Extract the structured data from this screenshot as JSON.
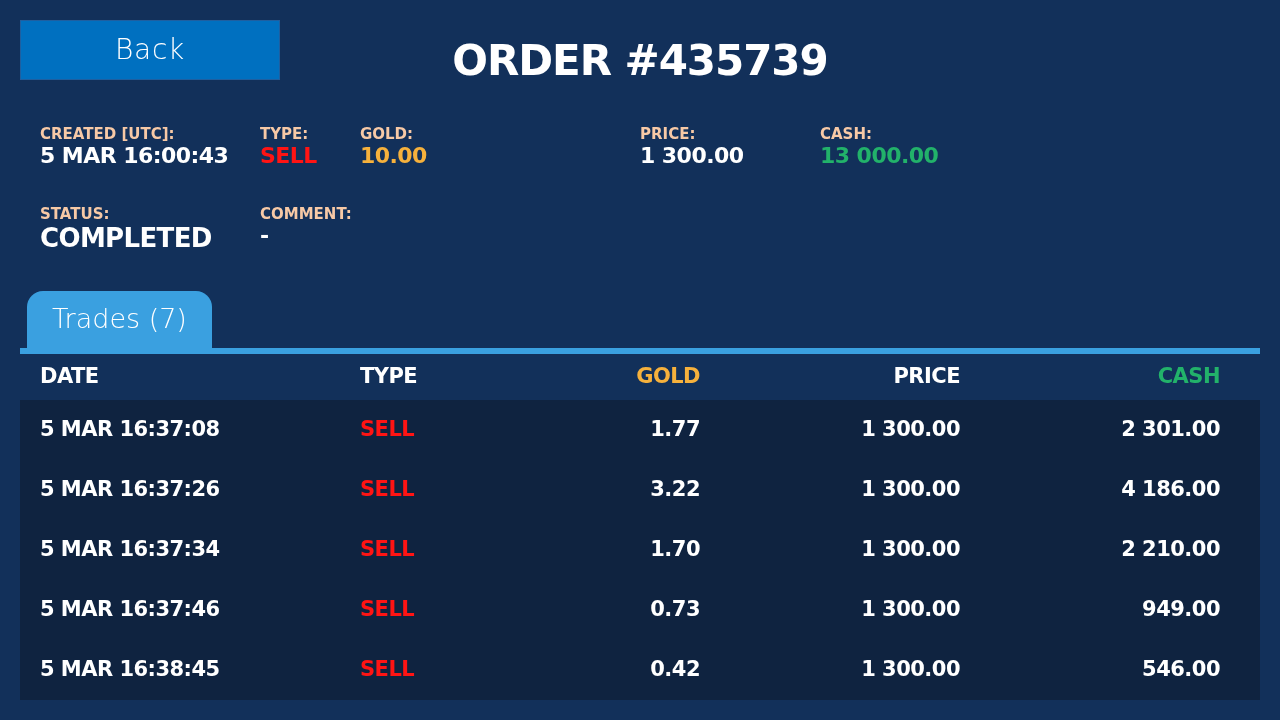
{
  "back_button": "Back",
  "title": "ORDER #435739",
  "detail_rows": [
    {
      "fields": [
        {
          "label": "CREATED [UTC]:",
          "value": "5 MAR 16:00:43",
          "kind": "plain"
        },
        {
          "label": "TYPE:",
          "value": "SELL",
          "kind": "sell"
        },
        {
          "label": "GOLD:",
          "value": "10.00",
          "kind": "gold"
        },
        {
          "label": "PRICE:",
          "value": "1 300.00",
          "kind": "plain"
        },
        {
          "label": "CASH:",
          "value": "13 000.00",
          "kind": "cash"
        }
      ]
    },
    {
      "fields": [
        {
          "label": "STATUS:",
          "value": "COMPLETED",
          "kind": "status"
        },
        {
          "label": "COMMENT:",
          "value": "-",
          "kind": "plain"
        }
      ]
    }
  ],
  "tabs": [
    {
      "label": "Trades (7)",
      "selected": true
    }
  ],
  "table": {
    "columns": [
      {
        "label": "DATE",
        "kind": "date"
      },
      {
        "label": "TYPE",
        "kind": "type"
      },
      {
        "label": "GOLD",
        "kind": "gold"
      },
      {
        "label": "PRICE",
        "kind": "price"
      },
      {
        "label": "CASH",
        "kind": "cash"
      }
    ],
    "rows": [
      {
        "kind": "sell",
        "cells": [
          "5 MAR 16:37:08",
          "SELL",
          "1.77",
          "1 300.00",
          "2 301.00"
        ]
      },
      {
        "kind": "sell",
        "cells": [
          "5 MAR 16:37:26",
          "SELL",
          "3.22",
          "1 300.00",
          "4 186.00"
        ]
      },
      {
        "kind": "sell",
        "cells": [
          "5 MAR 16:37:34",
          "SELL",
          "1.70",
          "1 300.00",
          "2 210.00"
        ]
      },
      {
        "kind": "sell",
        "cells": [
          "5 MAR 16:37:46",
          "SELL",
          "0.73",
          "1 300.00",
          "949.00"
        ]
      },
      {
        "kind": "sell",
        "cells": [
          "5 MAR 16:38:45",
          "SELL",
          "0.42",
          "1 300.00",
          "546.00"
        ]
      }
    ]
  }
}
